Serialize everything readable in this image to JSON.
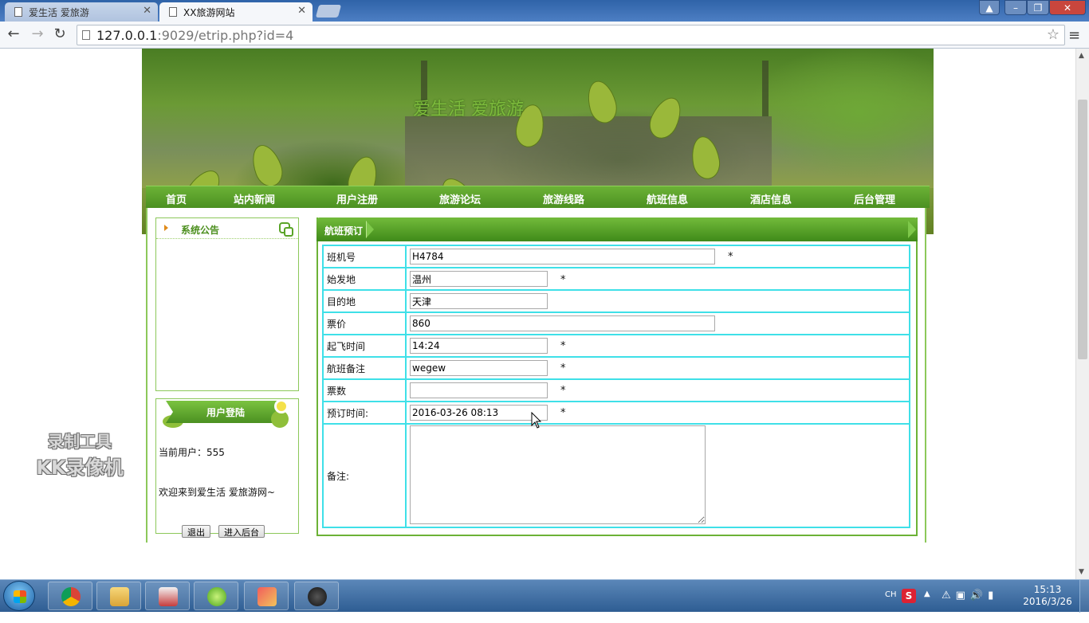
{
  "browser": {
    "tabs": [
      {
        "title": "爱生活 爱旅游",
        "active": false
      },
      {
        "title": "XX旅游网站",
        "active": true
      }
    ],
    "url_host": "127.0.0.1",
    "url_rest": ":9029/etrip.php?id=4"
  },
  "site": {
    "banner_title": "爱生活  爱旅游",
    "nav": [
      "首页",
      "站内新闻",
      "用户注册",
      "旅游论坛",
      "旅游线路",
      "航班信息",
      "酒店信息",
      "后台管理"
    ]
  },
  "sidebar": {
    "notice_title": "系统公告",
    "login_title": "用户登陆",
    "current_user": "当前用户：555",
    "welcome": "欢迎来到爱生活 爱旅游网~",
    "logout_label": "退出",
    "admin_label": "进入后台"
  },
  "form": {
    "title": "航班预订",
    "required_mark": "*",
    "rows": [
      {
        "label": "班机号",
        "value": "H4784"
      },
      {
        "label": "始发地",
        "value": "温州"
      },
      {
        "label": "目的地",
        "value": "天津"
      },
      {
        "label": "票价",
        "value": "860"
      },
      {
        "label": "起飞时间",
        "value": "14:24"
      },
      {
        "label": "航班备注",
        "value": "wegew"
      },
      {
        "label": "票数",
        "value": ""
      },
      {
        "label": "预订时间:",
        "value": "2016-03-26 08:13"
      },
      {
        "label": "备注:",
        "value": ""
      }
    ]
  },
  "watermark": {
    "line1": "录制工具",
    "line2": "KK录像机"
  },
  "taskbar": {
    "lang": "CH",
    "time": "15:13",
    "date": "2016/3/26"
  }
}
